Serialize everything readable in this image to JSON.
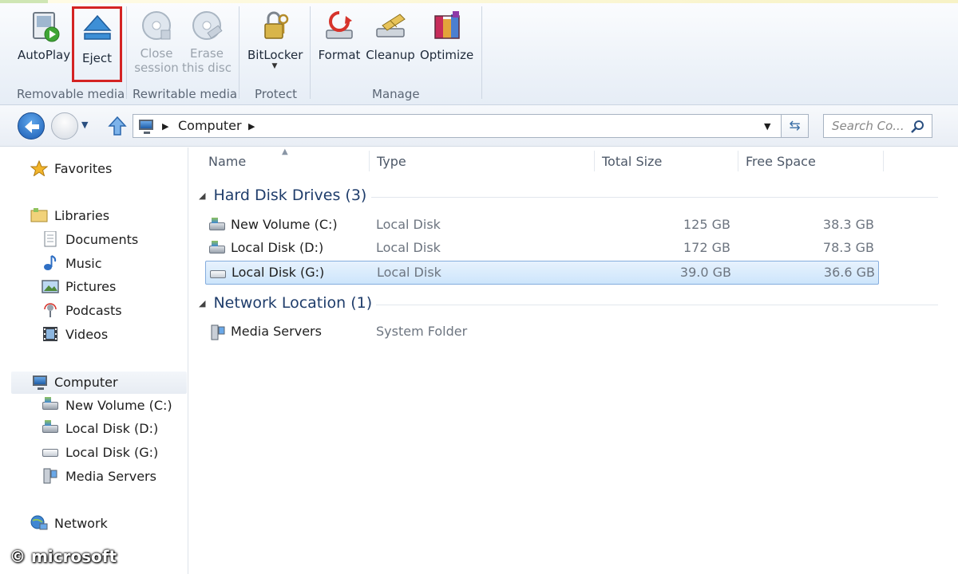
{
  "ribbon": {
    "buttons": {
      "autoplay": "AutoPlay",
      "eject": "Eject",
      "close_session_1": "Close",
      "close_session_2": "session",
      "erase_disc_1": "Erase",
      "erase_disc_2": "this disc",
      "bitlocker": "BitLocker",
      "format": "Format",
      "cleanup": "Cleanup",
      "optimize": "Optimize"
    },
    "groups": {
      "removable_media": "Removable media",
      "rewritable_media": "Rewritable media",
      "protect": "Protect",
      "manage": "Manage"
    },
    "highlight_color": "#d42323"
  },
  "address": {
    "crumbs": [
      "Computer"
    ]
  },
  "search": {
    "placeholder": "Search Co..."
  },
  "nav": {
    "favorites": "Favorites",
    "libraries": "Libraries",
    "documents": "Documents",
    "music": "Music",
    "pictures": "Pictures",
    "podcasts": "Podcasts",
    "videos": "Videos",
    "computer": "Computer",
    "new_volume_c": "New Volume (C:)",
    "local_disk_d": "Local Disk (D:)",
    "local_disk_g": "Local Disk (G:)",
    "media_servers": "Media Servers",
    "network": "Network"
  },
  "columns": {
    "name": "Name",
    "type": "Type",
    "total_size": "Total Size",
    "free_space": "Free Space"
  },
  "groups": {
    "hard_disk_drives": "Hard Disk Drives (3)",
    "network_location": "Network Location (1)"
  },
  "drives": [
    {
      "name": "New Volume (C:)",
      "type": "Local Disk",
      "total": "125 GB",
      "free": "38.3 GB"
    },
    {
      "name": "Local Disk (D:)",
      "type": "Local Disk",
      "total": "172 GB",
      "free": "78.3 GB"
    },
    {
      "name": "Local Disk (G:)",
      "type": "Local Disk",
      "total": "39.0 GB",
      "free": "36.6 GB"
    }
  ],
  "network_items": [
    {
      "name": "Media Servers",
      "type": "System Folder"
    }
  ],
  "watermark": "© microsoft"
}
